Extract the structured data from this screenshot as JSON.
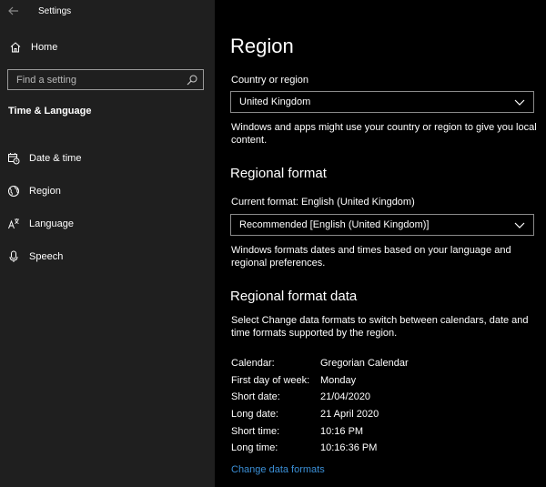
{
  "app": {
    "title": "Settings"
  },
  "sidebar": {
    "home_label": "Home",
    "search_placeholder": "Find a setting",
    "section_title": "Time & Language",
    "items": [
      {
        "label": "Date & time",
        "icon": "calendar-clock-icon"
      },
      {
        "label": "Region",
        "icon": "globe-icon"
      },
      {
        "label": "Language",
        "icon": "language-icon"
      },
      {
        "label": "Speech",
        "icon": "microphone-icon"
      }
    ]
  },
  "main": {
    "title": "Region",
    "country_label": "Country or region",
    "country_value": "United Kingdom",
    "country_desc": "Windows and apps might use your country or region to give you local content.",
    "regional_format_heading": "Regional format",
    "current_format_label": "Current format: English (United Kingdom)",
    "format_value": "Recommended [English (United Kingdom)]",
    "format_desc": "Windows formats dates and times based on your language and regional preferences.",
    "format_data_heading": "Regional format data",
    "format_data_desc": "Select Change data formats to switch between calendars, date and time formats supported by the region.",
    "format_data": [
      {
        "key": "Calendar:",
        "value": "Gregorian Calendar"
      },
      {
        "key": "First day of week:",
        "value": "Monday"
      },
      {
        "key": "Short date:",
        "value": "21/04/2020"
      },
      {
        "key": "Long date:",
        "value": "21 April 2020"
      },
      {
        "key": "Short time:",
        "value": "10:16 PM"
      },
      {
        "key": "Long time:",
        "value": "10:16:36 PM"
      }
    ],
    "change_link": "Change data formats"
  },
  "colors": {
    "sidebar_bg": "#1f1f1f",
    "main_bg": "#000000",
    "link": "#3b8fd6"
  }
}
